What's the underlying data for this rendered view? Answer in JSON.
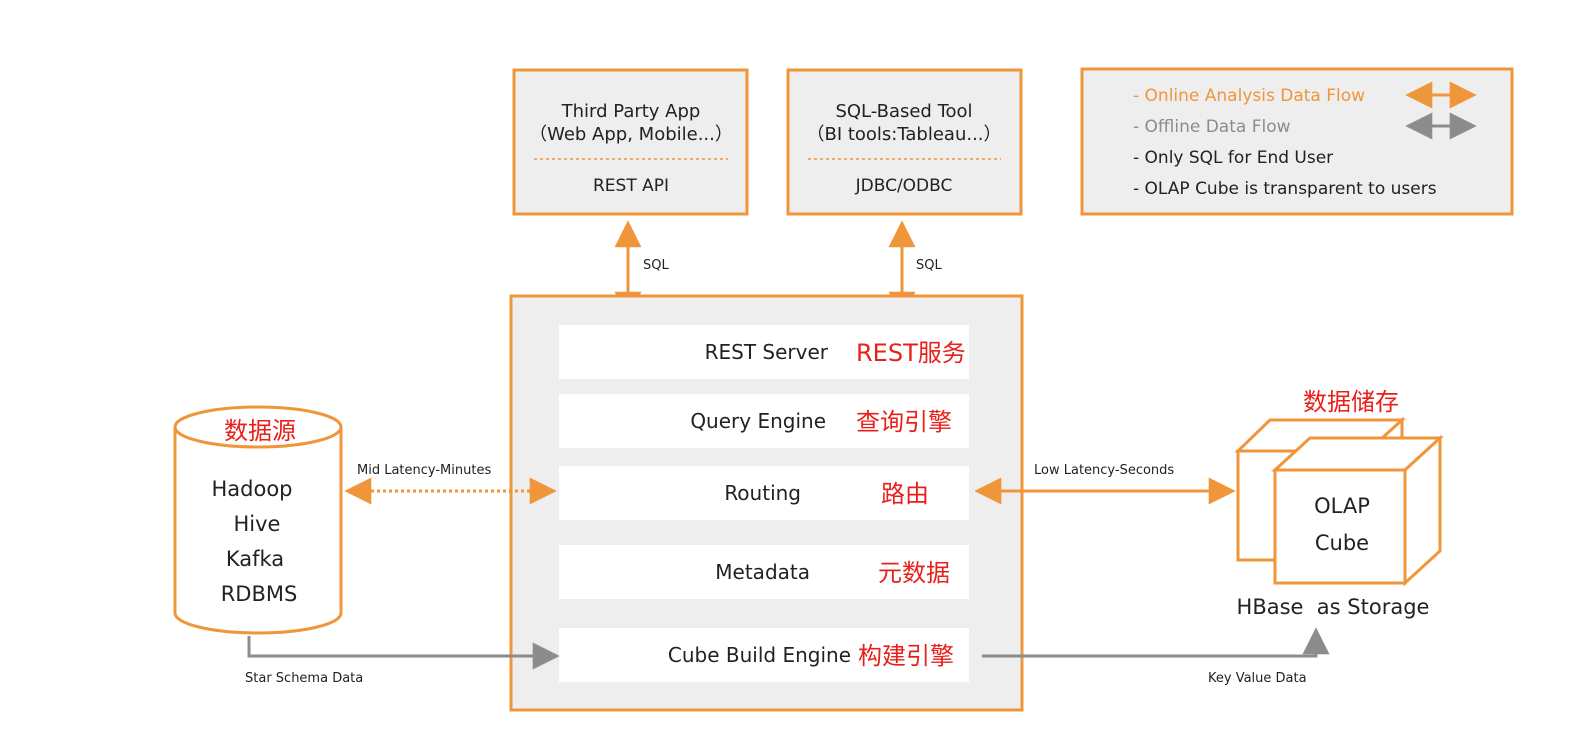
{
  "colors": {
    "accent_orange": "#f0963a",
    "box_fill": "#efeeee",
    "layer_fill": "#ffffff",
    "gray_arrow": "#8c8c8c",
    "cn_red": "#e8201c",
    "text_dark": "#222222"
  },
  "clients": [
    {
      "title": "Third Party App",
      "subtitle": "（Web App, Mobile...）",
      "api": "REST API",
      "arrow_label": "SQL"
    },
    {
      "title": "SQL-Based Tool",
      "subtitle": "（BI tools:Tableau...）",
      "api": "JDBC/ODBC",
      "arrow_label": "SQL"
    }
  ],
  "legend": {
    "items": [
      {
        "text": "- Online Analysis Data Flow",
        "color": "#f0963a",
        "arrow": "orange-double-arrow"
      },
      {
        "text": "- Offline Data Flow",
        "color": "#8c8c8c",
        "arrow": "gray-double-arrow"
      },
      {
        "text": "- Only SQL for End User",
        "color": "#222222"
      },
      {
        "text": "- OLAP Cube is transparent to users",
        "color": "#222222"
      }
    ]
  },
  "layers": [
    {
      "en": "REST Server",
      "cn": "REST服务"
    },
    {
      "en": "Query Engine",
      "cn": "查询引擎"
    },
    {
      "en": "Routing",
      "cn": "路由"
    },
    {
      "en": "Metadata",
      "cn": "元数据"
    },
    {
      "en": "Cube Build Engine",
      "cn": "构建引擎"
    }
  ],
  "datasource": {
    "cn_title": "数据源",
    "items": [
      "Hadoop",
      "Hive",
      "Kafka",
      "RDBMS"
    ]
  },
  "storage": {
    "cn_title": "数据储存",
    "cube_line1": "OLAP",
    "cube_line2": "Cube",
    "caption": "HBase  as Storage"
  },
  "flows": {
    "mid_latency": "Mid Latency-Minutes",
    "low_latency": "Low Latency-Seconds",
    "star_schema": "Star Schema Data",
    "key_value": "Key Value Data"
  }
}
